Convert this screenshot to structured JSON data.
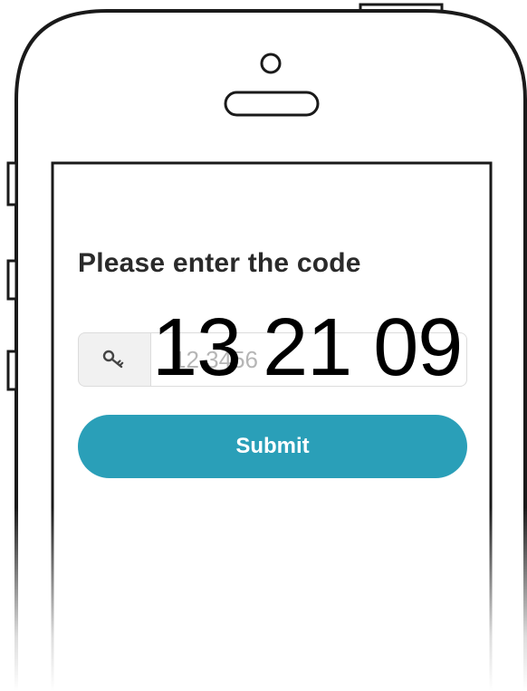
{
  "prompt": {
    "title": "Please enter the code"
  },
  "code_input": {
    "placeholder": "12 3456",
    "icon": "key-icon"
  },
  "overlay": {
    "code": "13 21 09"
  },
  "submit": {
    "label": "Submit"
  },
  "colors": {
    "accent": "#2a9fb8",
    "title_text": "#2a2a2a",
    "outline": "#1a1a1a",
    "input_border": "#dcdcdc",
    "addon_background": "#f1f1f1"
  }
}
